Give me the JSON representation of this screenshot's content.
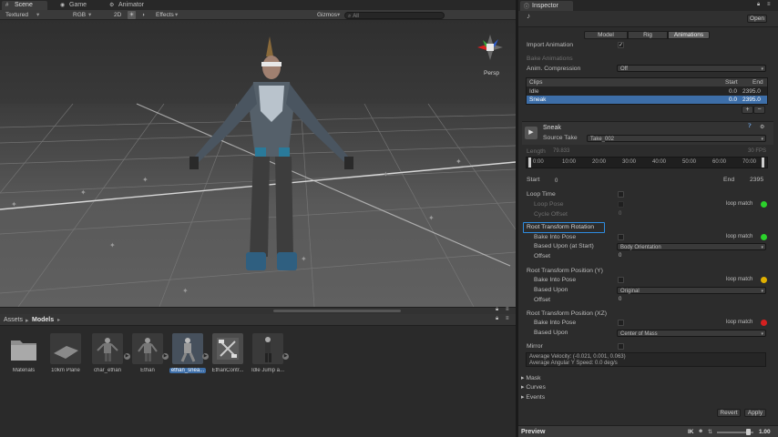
{
  "tabs": {
    "scene": "Scene",
    "game": "Game",
    "animator": "Animator"
  },
  "scene_toolbar": {
    "shading_mode": "Textured",
    "render_mode": "RGB",
    "mode_2d": "2D",
    "effects": "Effects",
    "gizmos": "Gizmos",
    "search_placeholder": "All"
  },
  "viewport": {
    "projection_label": "Persp",
    "colors": {
      "sky": "#2d2d2d",
      "ground": "#585858",
      "grid_line": "#8a8a8a"
    }
  },
  "project": {
    "breadcrumb_root": "Assets",
    "breadcrumb_sep": "▸",
    "breadcrumb_folder": "Models",
    "assets": [
      {
        "label": "Materials",
        "icon": "folder-icon"
      },
      {
        "label": "10km Plane",
        "icon": "plane-mesh-icon"
      },
      {
        "label": "char_ethan",
        "icon": "character-model-icon"
      },
      {
        "label": "Ethan",
        "icon": "character-model-icon"
      },
      {
        "label": "ethan_snea...",
        "icon": "character-model-icon",
        "selected": true
      },
      {
        "label": "EthanContr...",
        "icon": "animator-controller-icon"
      },
      {
        "label": "Idle Jump a...",
        "icon": "character-model-icon"
      }
    ]
  },
  "inspector": {
    "title": "Inspector",
    "open_button": "Open",
    "import_tabs": [
      "Model",
      "Rig",
      "Animations"
    ],
    "active_tab": "Animations",
    "import_animation_label": "Import Animation",
    "bake_animations_label": "Bake Animations",
    "anim_compression_label": "Anim. Compression",
    "anim_compression_value": "Off",
    "clips_header": {
      "name": "Clips",
      "start": "Start",
      "end": "End"
    },
    "clips": [
      {
        "name": "Idle",
        "start": "0.0",
        "end": "2395.0",
        "selected": false
      },
      {
        "name": "Sneak",
        "start": "0.0",
        "end": "2395.0",
        "selected": true
      }
    ],
    "add_clip": "+",
    "remove_clip": "−",
    "clip_name": "Sneak",
    "source_take_label": "Source Take",
    "source_take_value": "Take_002",
    "length_label": "Length",
    "length_value": "79.833",
    "fps_value": "30 FPS",
    "timeline_ticks": [
      "0:00",
      "10:00",
      "20:00",
      "30:00",
      "40:00",
      "50:00",
      "60:00",
      "70:00"
    ],
    "start_label": "Start",
    "start_value": "0",
    "end_label": "End",
    "end_value": "2395",
    "loop_time_label": "Loop Time",
    "loop_pose_label": "Loop Pose",
    "cycle_offset_label": "Cycle Offset",
    "cycle_offset_value": "0",
    "loop_match": "loop match",
    "rtr_header": "Root Transform Rotation",
    "bake_into_pose_label": "Bake Into Pose",
    "based_upon_at_start_label": "Based Upon (at Start)",
    "based_upon_rotation_value": "Body Orientation",
    "offset_label": "Offset",
    "offset_rotation_value": "0",
    "rtpy_header": "Root Transform Position (Y)",
    "based_upon_label": "Based Upon",
    "based_upon_y_value": "Original",
    "offset_y_value": "0",
    "rtpxz_header": "Root Transform Position (XZ)",
    "based_upon_xz_value": "Center of Mass",
    "mirror_label": "Mirror",
    "avg_velocity": "Average Velocity: (-0.021, 0.001, 0.063)",
    "avg_angular": "Average Angular Y Speed: 0.0 deg/s",
    "mask_label": "Mask",
    "curves_label": "Curves",
    "events_label": "Events",
    "revert_button": "Revert",
    "apply_button": "Apply",
    "preview_label": "Preview",
    "ik_label": "IK",
    "speed_value": "1.00",
    "status_colors": {
      "green": "#2bd22b",
      "yellow": "#e0b000",
      "red": "#d42020",
      "highlight": "#2e8ce0",
      "selection": "#3d6ea8"
    }
  }
}
